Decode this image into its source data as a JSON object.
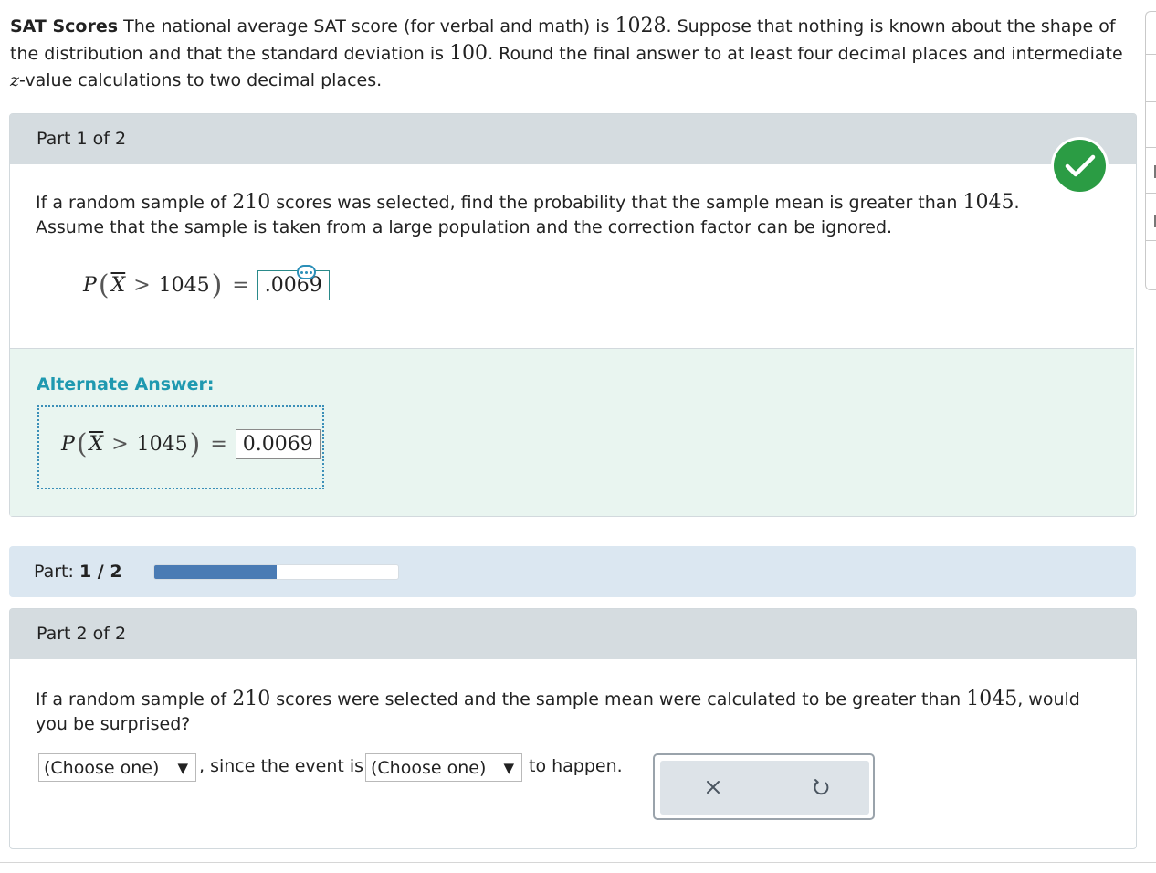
{
  "problem": {
    "title": "SAT Scores",
    "t1": "The national average SAT score (for verbal and math) is",
    "mean": "1028",
    "t2": ". Suppose that nothing is known about the shape of the distribution and that the standard deviation is",
    "sd": "100",
    "t3": ". Round the final answer to at least four decimal places and intermediate",
    "zvar": "z",
    "t4": "-value calculations to two decimal places."
  },
  "part1": {
    "header": "Part 1 of 2",
    "q1": "If a random sample of",
    "n": "210",
    "q2": "scores was selected, find the probability that the sample mean is greater than",
    "x": "1045",
    "q3": ". Assume that the sample is taken from a large population and the correction factor can be ignored.",
    "eq_p": "P",
    "eq_xbar": "X",
    "eq_gt": ">",
    "eq_value": "1045",
    "eq_equals": "=",
    "answer": ".0069",
    "alt_title": "Alternate Answer:",
    "alt_answer": "0.0069"
  },
  "progress": {
    "label": "Part:",
    "current": "1 / 2",
    "fraction": 0.5
  },
  "part2": {
    "header": "Part 2 of 2",
    "q1": "If a random sample of",
    "n": "210",
    "q2": "scores were selected and the sample mean were calculated to be greater than",
    "x": "1045",
    "q3": ", would you be surprised?",
    "select1": "(Choose one)",
    "mid": ", since the event is",
    "select2": "(Choose one)",
    "end": "to happen."
  },
  "icons": {
    "correct": "check-icon",
    "more": "ellipsis-icon",
    "clear": "close-icon",
    "reset": "undo-icon",
    "dropdown": "triangle-down-icon"
  },
  "colors": {
    "correct": "#2b9c44",
    "accent": "#1f99b0",
    "progress": "#4a7bb4"
  }
}
